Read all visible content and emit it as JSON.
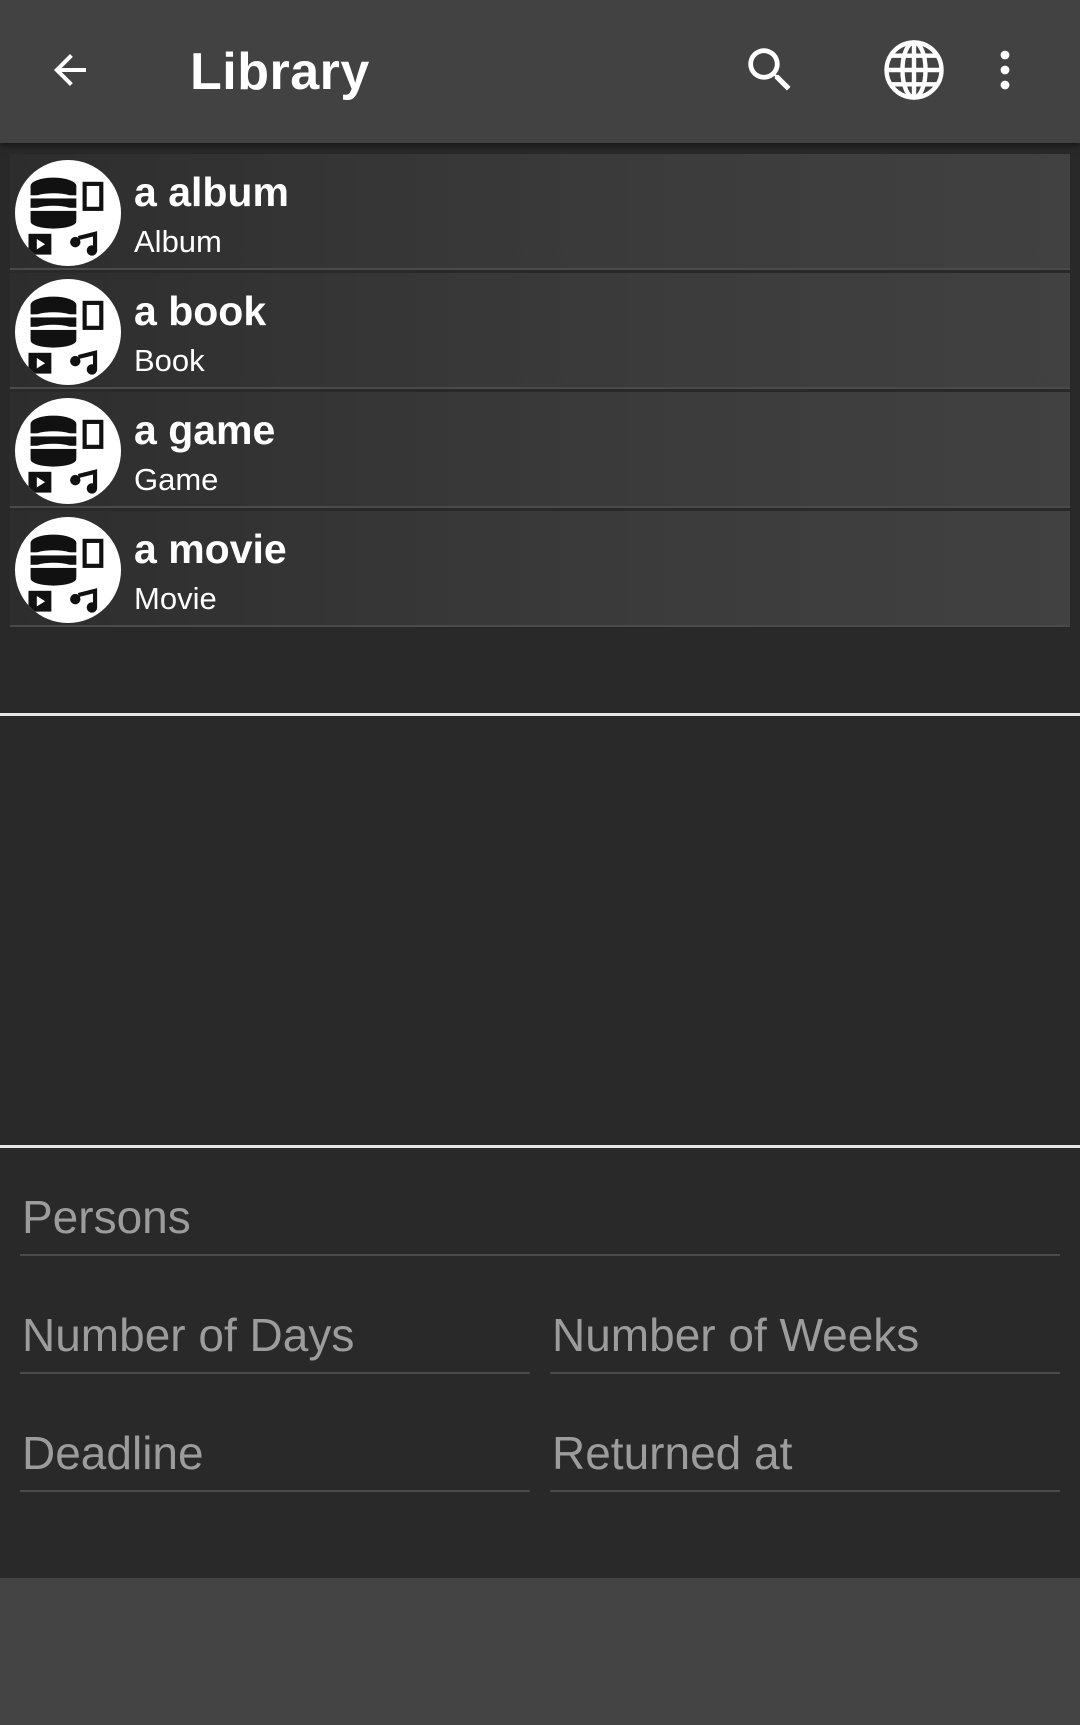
{
  "header": {
    "title": "Library",
    "back_icon": "arrow-back-icon",
    "search_icon": "search-icon",
    "language_icon": "globe-icon",
    "overflow_icon": "more-vert-icon"
  },
  "items": [
    {
      "title": "a album",
      "type": "Album",
      "icon": "media-library-icon"
    },
    {
      "title": "a book",
      "type": "Book",
      "icon": "media-library-icon"
    },
    {
      "title": "a game",
      "type": "Game",
      "icon": "media-library-icon"
    },
    {
      "title": "a movie",
      "type": "Movie",
      "icon": "media-library-icon"
    }
  ],
  "form": {
    "persons_placeholder": "Persons",
    "days_placeholder": "Number of Days",
    "weeks_placeholder": "Number of Weeks",
    "deadline_placeholder": "Deadline",
    "returned_placeholder": "Returned at"
  },
  "colors": {
    "app_bar": "#424242",
    "background": "#292929",
    "divider": "#e6e6e6",
    "hint_text": "#9c9c9c"
  }
}
